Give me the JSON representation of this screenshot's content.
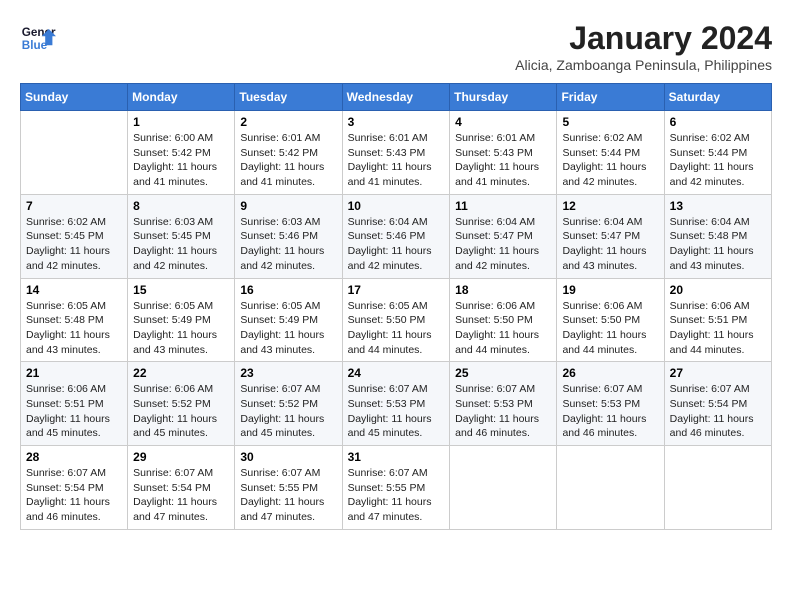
{
  "logo": {
    "line1": "General",
    "line2": "Blue"
  },
  "title": "January 2024",
  "subtitle": "Alicia, Zamboanga Peninsula, Philippines",
  "headers": [
    "Sunday",
    "Monday",
    "Tuesday",
    "Wednesday",
    "Thursday",
    "Friday",
    "Saturday"
  ],
  "weeks": [
    {
      "days": [
        {
          "num": "",
          "info": ""
        },
        {
          "num": "1",
          "info": "Sunrise: 6:00 AM\nSunset: 5:42 PM\nDaylight: 11 hours\nand 41 minutes."
        },
        {
          "num": "2",
          "info": "Sunrise: 6:01 AM\nSunset: 5:42 PM\nDaylight: 11 hours\nand 41 minutes."
        },
        {
          "num": "3",
          "info": "Sunrise: 6:01 AM\nSunset: 5:43 PM\nDaylight: 11 hours\nand 41 minutes."
        },
        {
          "num": "4",
          "info": "Sunrise: 6:01 AM\nSunset: 5:43 PM\nDaylight: 11 hours\nand 41 minutes."
        },
        {
          "num": "5",
          "info": "Sunrise: 6:02 AM\nSunset: 5:44 PM\nDaylight: 11 hours\nand 42 minutes."
        },
        {
          "num": "6",
          "info": "Sunrise: 6:02 AM\nSunset: 5:44 PM\nDaylight: 11 hours\nand 42 minutes."
        }
      ]
    },
    {
      "days": [
        {
          "num": "7",
          "info": "Sunrise: 6:02 AM\nSunset: 5:45 PM\nDaylight: 11 hours\nand 42 minutes."
        },
        {
          "num": "8",
          "info": "Sunrise: 6:03 AM\nSunset: 5:45 PM\nDaylight: 11 hours\nand 42 minutes."
        },
        {
          "num": "9",
          "info": "Sunrise: 6:03 AM\nSunset: 5:46 PM\nDaylight: 11 hours\nand 42 minutes."
        },
        {
          "num": "10",
          "info": "Sunrise: 6:04 AM\nSunset: 5:46 PM\nDaylight: 11 hours\nand 42 minutes."
        },
        {
          "num": "11",
          "info": "Sunrise: 6:04 AM\nSunset: 5:47 PM\nDaylight: 11 hours\nand 42 minutes."
        },
        {
          "num": "12",
          "info": "Sunrise: 6:04 AM\nSunset: 5:47 PM\nDaylight: 11 hours\nand 43 minutes."
        },
        {
          "num": "13",
          "info": "Sunrise: 6:04 AM\nSunset: 5:48 PM\nDaylight: 11 hours\nand 43 minutes."
        }
      ]
    },
    {
      "days": [
        {
          "num": "14",
          "info": "Sunrise: 6:05 AM\nSunset: 5:48 PM\nDaylight: 11 hours\nand 43 minutes."
        },
        {
          "num": "15",
          "info": "Sunrise: 6:05 AM\nSunset: 5:49 PM\nDaylight: 11 hours\nand 43 minutes."
        },
        {
          "num": "16",
          "info": "Sunrise: 6:05 AM\nSunset: 5:49 PM\nDaylight: 11 hours\nand 43 minutes."
        },
        {
          "num": "17",
          "info": "Sunrise: 6:05 AM\nSunset: 5:50 PM\nDaylight: 11 hours\nand 44 minutes."
        },
        {
          "num": "18",
          "info": "Sunrise: 6:06 AM\nSunset: 5:50 PM\nDaylight: 11 hours\nand 44 minutes."
        },
        {
          "num": "19",
          "info": "Sunrise: 6:06 AM\nSunset: 5:50 PM\nDaylight: 11 hours\nand 44 minutes."
        },
        {
          "num": "20",
          "info": "Sunrise: 6:06 AM\nSunset: 5:51 PM\nDaylight: 11 hours\nand 44 minutes."
        }
      ]
    },
    {
      "days": [
        {
          "num": "21",
          "info": "Sunrise: 6:06 AM\nSunset: 5:51 PM\nDaylight: 11 hours\nand 45 minutes."
        },
        {
          "num": "22",
          "info": "Sunrise: 6:06 AM\nSunset: 5:52 PM\nDaylight: 11 hours\nand 45 minutes."
        },
        {
          "num": "23",
          "info": "Sunrise: 6:07 AM\nSunset: 5:52 PM\nDaylight: 11 hours\nand 45 minutes."
        },
        {
          "num": "24",
          "info": "Sunrise: 6:07 AM\nSunset: 5:53 PM\nDaylight: 11 hours\nand 45 minutes."
        },
        {
          "num": "25",
          "info": "Sunrise: 6:07 AM\nSunset: 5:53 PM\nDaylight: 11 hours\nand 46 minutes."
        },
        {
          "num": "26",
          "info": "Sunrise: 6:07 AM\nSunset: 5:53 PM\nDaylight: 11 hours\nand 46 minutes."
        },
        {
          "num": "27",
          "info": "Sunrise: 6:07 AM\nSunset: 5:54 PM\nDaylight: 11 hours\nand 46 minutes."
        }
      ]
    },
    {
      "days": [
        {
          "num": "28",
          "info": "Sunrise: 6:07 AM\nSunset: 5:54 PM\nDaylight: 11 hours\nand 46 minutes."
        },
        {
          "num": "29",
          "info": "Sunrise: 6:07 AM\nSunset: 5:54 PM\nDaylight: 11 hours\nand 47 minutes."
        },
        {
          "num": "30",
          "info": "Sunrise: 6:07 AM\nSunset: 5:55 PM\nDaylight: 11 hours\nand 47 minutes."
        },
        {
          "num": "31",
          "info": "Sunrise: 6:07 AM\nSunset: 5:55 PM\nDaylight: 11 hours\nand 47 minutes."
        },
        {
          "num": "",
          "info": ""
        },
        {
          "num": "",
          "info": ""
        },
        {
          "num": "",
          "info": ""
        }
      ]
    }
  ]
}
